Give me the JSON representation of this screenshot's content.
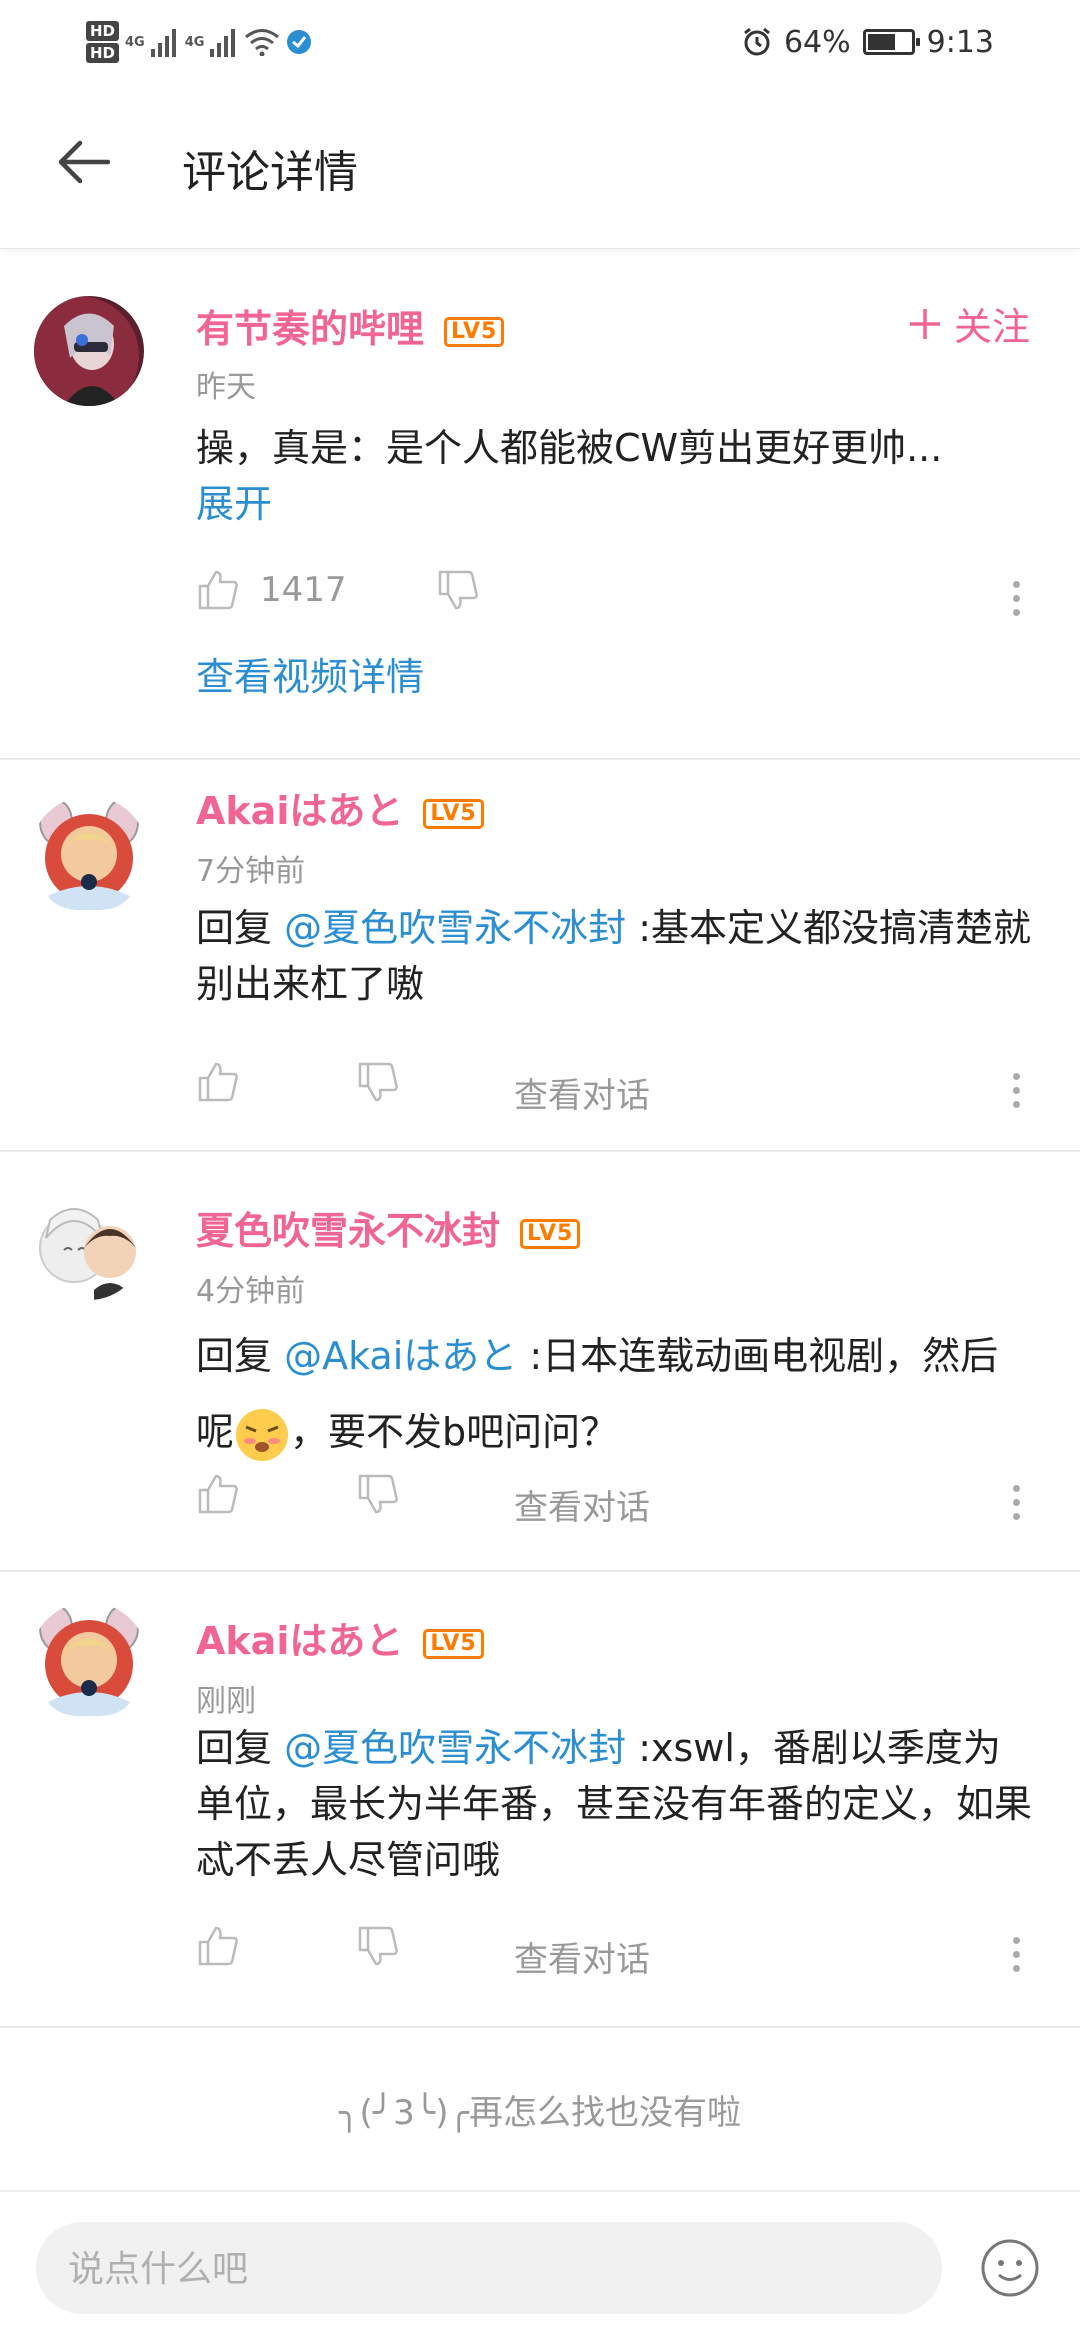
{
  "status_bar": {
    "hd1": "HD",
    "hd2": "HD",
    "net1": "4G",
    "net2": "4G",
    "battery_percent": "64%",
    "time": "9:13",
    "battery_level": 0.64
  },
  "appbar": {
    "title": "评论详情"
  },
  "comments": [
    {
      "username": "有节奏的哔哩",
      "level": "LV5",
      "time": "昨天",
      "text": "操，真是：是个人都能被CW剪出更好更帅...",
      "expand": "展开",
      "likes": "1417",
      "follow": "关注",
      "view_video": "查看视频详情"
    },
    {
      "username": "Akaiはあと",
      "level": "LV5",
      "time": "7分钟前",
      "reply_prefix": "回复 ",
      "mention": "@夏色吹雪永不冰封",
      "text": " :基本定义都没搞清楚就别出来杠了嗷",
      "view_convo": "查看对话"
    },
    {
      "username": "夏色吹雪永不冰封",
      "level": "LV5",
      "time": "4分钟前",
      "reply_prefix": "回复 ",
      "mention": "@Akaiはあと",
      "text": " :日本连载动画电视剧，然后呢",
      "text_after": "，要不发b吧问问？",
      "view_convo": "查看对话"
    },
    {
      "username": "Akaiはあと",
      "level": "LV5",
      "time": "刚刚",
      "reply_prefix": "回复 ",
      "mention": "@夏色吹雪永不冰封",
      "text": " :xswl，番剧以季度为单位，最长为半年番，甚至没有年番的定义，如果忒不丢人尽管问哦",
      "view_convo": "查看对话"
    }
  ],
  "end_message": "╮(╯3╰)╭再怎么找也没有啦",
  "input": {
    "placeholder": "说点什么吧"
  },
  "colors": {
    "username": "#f06595",
    "link": "#2a8ed0",
    "level_badge": "#ff7b00"
  }
}
